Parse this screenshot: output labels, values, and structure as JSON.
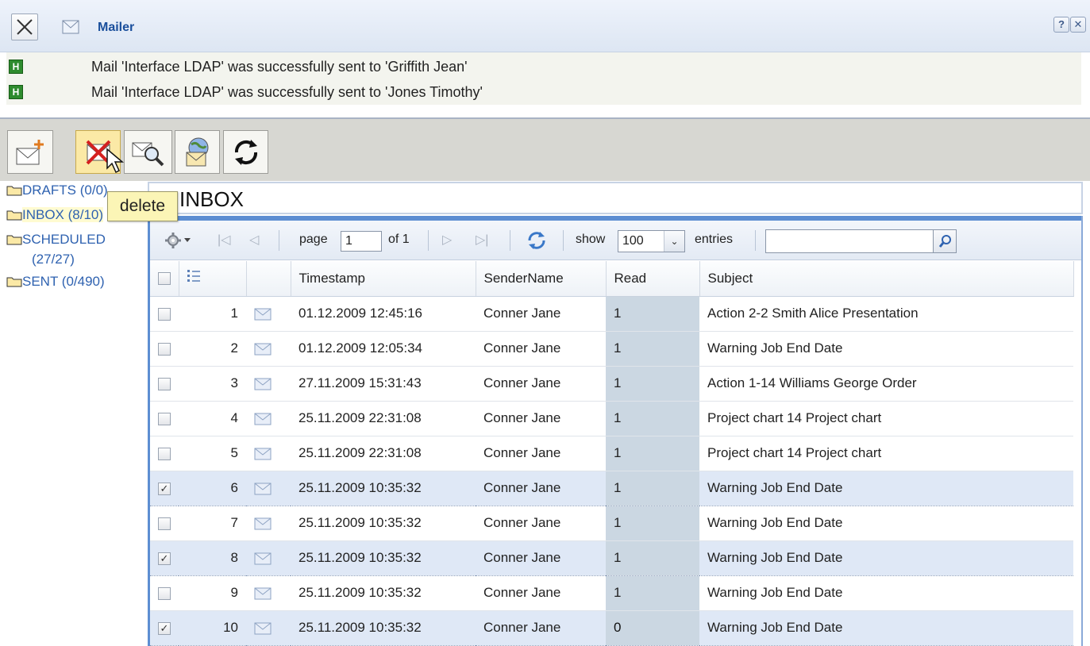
{
  "window": {
    "title": "Mailer",
    "help_label": "?",
    "close_label": "✕"
  },
  "messages": [
    {
      "status_icon": "H",
      "text": "Mail 'Interface LDAP' was successfully sent to 'Griffith Jean'"
    },
    {
      "status_icon": "H",
      "text": "Mail 'Interface LDAP' was successfully sent to 'Jones Timothy'"
    }
  ],
  "toolbar": {
    "buttons": [
      "new-mail",
      "delete",
      "search-mail",
      "send-receive",
      "refresh"
    ],
    "tooltip": "delete"
  },
  "folders": [
    {
      "name": "DRAFTS",
      "count": "(0/0)"
    },
    {
      "name": "INBOX",
      "count": "(8/10)"
    },
    {
      "name": "SCHEDULED",
      "count": "(27/27)"
    },
    {
      "name": "SENT",
      "count": "(0/490)"
    }
  ],
  "box_title": "INBOX",
  "pager": {
    "page_label": "page",
    "page_value": "1",
    "of_label": "of 1",
    "show_label": "show",
    "page_size": "100",
    "entries_label": "entries",
    "search_value": ""
  },
  "columns": [
    "Timestamp",
    "SenderName",
    "Read",
    "Subject"
  ],
  "rows": [
    {
      "n": "1",
      "checked": false,
      "ts": "01.12.2009 12:45:16",
      "sender": "Conner Jane",
      "read": "1",
      "subject": "Action 2-2 Smith Alice Presentation"
    },
    {
      "n": "2",
      "checked": false,
      "ts": "01.12.2009 12:05:34",
      "sender": "Conner Jane",
      "read": "1",
      "subject": "Warning Job End Date"
    },
    {
      "n": "3",
      "checked": false,
      "ts": "27.11.2009 15:31:43",
      "sender": "Conner Jane",
      "read": "1",
      "subject": "Action 1-14 Williams George Order"
    },
    {
      "n": "4",
      "checked": false,
      "ts": "25.11.2009 22:31:08",
      "sender": "Conner Jane",
      "read": "1",
      "subject": "Project chart 14 Project chart"
    },
    {
      "n": "5",
      "checked": false,
      "ts": "25.11.2009 22:31:08",
      "sender": "Conner Jane",
      "read": "1",
      "subject": "Project chart 14 Project chart"
    },
    {
      "n": "6",
      "checked": true,
      "ts": "25.11.2009 10:35:32",
      "sender": "Conner Jane",
      "read": "1",
      "subject": "Warning Job End Date"
    },
    {
      "n": "7",
      "checked": false,
      "ts": "25.11.2009 10:35:32",
      "sender": "Conner Jane",
      "read": "1",
      "subject": "Warning Job End Date"
    },
    {
      "n": "8",
      "checked": true,
      "ts": "25.11.2009 10:35:32",
      "sender": "Conner Jane",
      "read": "1",
      "subject": "Warning Job End Date"
    },
    {
      "n": "9",
      "checked": false,
      "ts": "25.11.2009 10:35:32",
      "sender": "Conner Jane",
      "read": "1",
      "subject": "Warning Job End Date"
    },
    {
      "n": "10",
      "checked": true,
      "ts": "25.11.2009 10:35:32",
      "sender": "Conner Jane",
      "read": "0",
      "subject": "Warning Job End Date"
    }
  ],
  "colors": {
    "accent": "#5d8ed2",
    "unread": "#4b94ee",
    "selected_row": "#dfe8f6",
    "tooltip": "#fbf5b6"
  }
}
